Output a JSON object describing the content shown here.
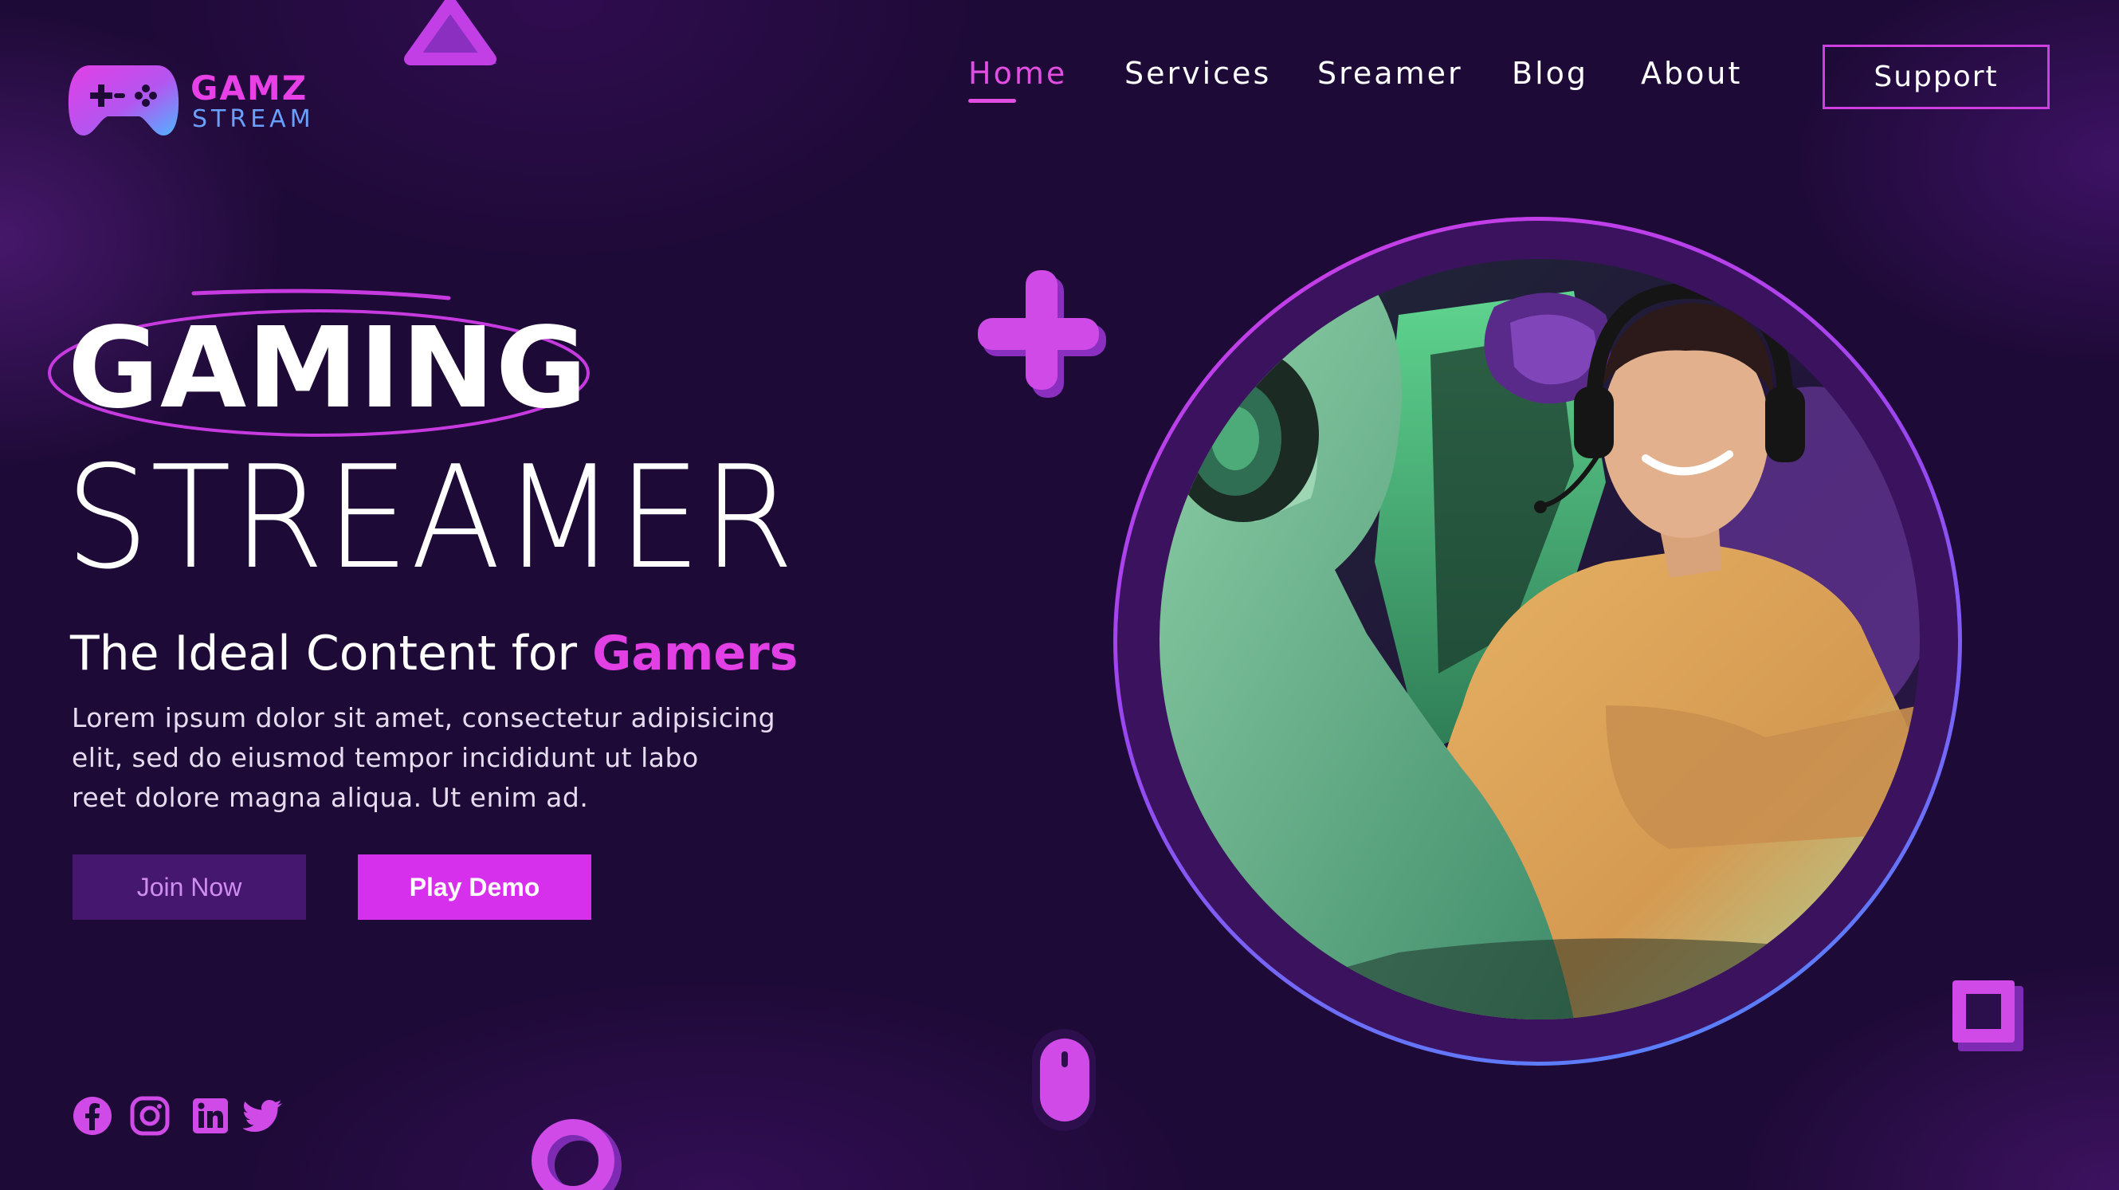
{
  "brand": {
    "title": "GAMZ",
    "subtitle": "STREAM",
    "icon": "gamepad-icon"
  },
  "nav": {
    "items": [
      {
        "label": "Home",
        "active": true
      },
      {
        "label": "Services",
        "active": false
      },
      {
        "label": "Sreamer",
        "active": false
      },
      {
        "label": "Blog",
        "active": false
      },
      {
        "label": "About",
        "active": false
      }
    ],
    "support_label": "Support"
  },
  "hero": {
    "title_line1": "GAMING",
    "title_line2": "STREAMER",
    "subtitle_prefix": "The Ideal Content for ",
    "subtitle_accent": "Gamers",
    "body_lines": [
      "Lorem ipsum dolor sit amet, consectetur adipisicing",
      "elit, sed do eiusmod tempor incididunt ut labo",
      "reet dolore magna aliqua. Ut enim ad."
    ],
    "join_label": "Join Now",
    "demo_label": "Play Demo"
  },
  "socials": [
    "facebook-icon",
    "instagram-icon",
    "linkedin-icon",
    "twitter-icon"
  ],
  "decorations": [
    "triangle-icon",
    "plus-icon",
    "circle-icon",
    "square-icon",
    "mouse-icon"
  ],
  "colors": {
    "background": "#1d0a36",
    "accent": "#e23fe5",
    "button_secondary": "#46176f",
    "logo_blue": "#6aa0ff"
  }
}
